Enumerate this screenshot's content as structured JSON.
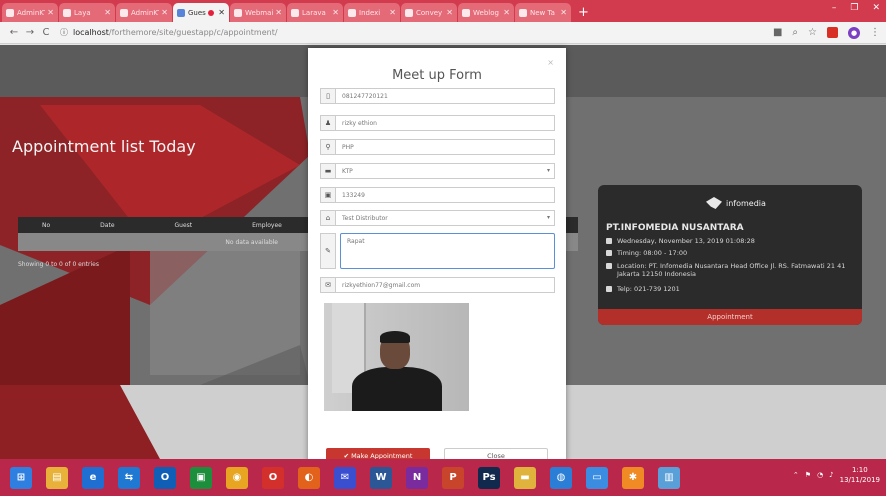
{
  "browser": {
    "tabs": [
      {
        "title": "AdminKT"
      },
      {
        "title": "Laya"
      },
      {
        "title": "AdminKT"
      },
      {
        "title": "Gues",
        "active": true
      },
      {
        "title": "Webmai"
      },
      {
        "title": "Larava"
      },
      {
        "title": "Indexi"
      },
      {
        "title": "Convey"
      },
      {
        "title": "Weblog"
      },
      {
        "title": "New Ta"
      }
    ],
    "new_tab": "+",
    "address": {
      "host": "localhost",
      "path": "/forthemore/site/guestapp/c/appointment/"
    },
    "window_controls": [
      "–",
      "❐",
      "✕"
    ]
  },
  "page": {
    "heading": "Appointment list Today",
    "table_headers": [
      "No",
      "Date",
      "Guest",
      "Employee"
    ],
    "empty_text": "No data available",
    "showing_text": "Showing 0 to 0 of 0 entries"
  },
  "card": {
    "logo_text": "infomedia",
    "company": "PT.INFOMEDIA NUSANTARA",
    "date_line": "Wednesday, November 13, 2019 01:08:28",
    "hours_line": "Timing: 08:00 - 17:00",
    "location_line": "Location: PT. Infomedia Nusantara Head Office Jl. RS. Fatmawati 21 41 Jakarta 12150 Indonesia",
    "phone_line": "Telp: 021-739 1201",
    "footer": "Appointment"
  },
  "modal": {
    "title": "Meet up Form",
    "close_symbol": "×",
    "phone": "081247720121",
    "name": "rizky ethion",
    "company": "PHP",
    "category": "KTP",
    "id_number": "133249",
    "employee": "Test Distributor",
    "purpose": "Rapat",
    "email": "rizkyethion77@gmail.com",
    "make_button": "Make Appointment",
    "close_button": "Close"
  },
  "taskbar": {
    "apps": [
      {
        "name": "windows-start-icon",
        "color": "#2f7fe0",
        "glyph": "⊞"
      },
      {
        "name": "file-explorer-icon",
        "color": "#e8b23a",
        "glyph": "▤"
      },
      {
        "name": "internet-explorer-icon",
        "color": "#1e6fd1",
        "glyph": "e"
      },
      {
        "name": "teamviewer-icon",
        "color": "#1f78d1",
        "glyph": "⇆"
      },
      {
        "name": "outlook-icon",
        "color": "#0f5fb6",
        "glyph": "O"
      },
      {
        "name": "store-icon",
        "color": "#1d8f3c",
        "glyph": "▣"
      },
      {
        "name": "chrome-icon",
        "color": "#e7a521",
        "glyph": "◉"
      },
      {
        "name": "opera-icon",
        "color": "#d4302b",
        "glyph": "O"
      },
      {
        "name": "firefox-icon",
        "color": "#e2621b",
        "glyph": "◐"
      },
      {
        "name": "mail-icon",
        "color": "#3a4fd0",
        "glyph": "✉"
      },
      {
        "name": "word-icon",
        "color": "#2b5797",
        "glyph": "W"
      },
      {
        "name": "onenote-icon",
        "color": "#7a2c9e",
        "glyph": "N"
      },
      {
        "name": "powerpoint-icon",
        "color": "#c8442a",
        "glyph": "P"
      },
      {
        "name": "photoshop-icon",
        "color": "#12294e",
        "glyph": "Ps"
      },
      {
        "name": "folder-icon",
        "color": "#e0b33c",
        "glyph": "▬"
      },
      {
        "name": "network-icon",
        "color": "#2a7ed6",
        "glyph": "◍"
      },
      {
        "name": "pc-icon",
        "color": "#3a8de0",
        "glyph": "▭"
      },
      {
        "name": "xampp-icon",
        "color": "#f08a24",
        "glyph": "✱"
      },
      {
        "name": "notepad-icon",
        "color": "#5aa0d8",
        "glyph": "▥"
      }
    ],
    "time": "1:10",
    "date": "13/11/2019"
  }
}
